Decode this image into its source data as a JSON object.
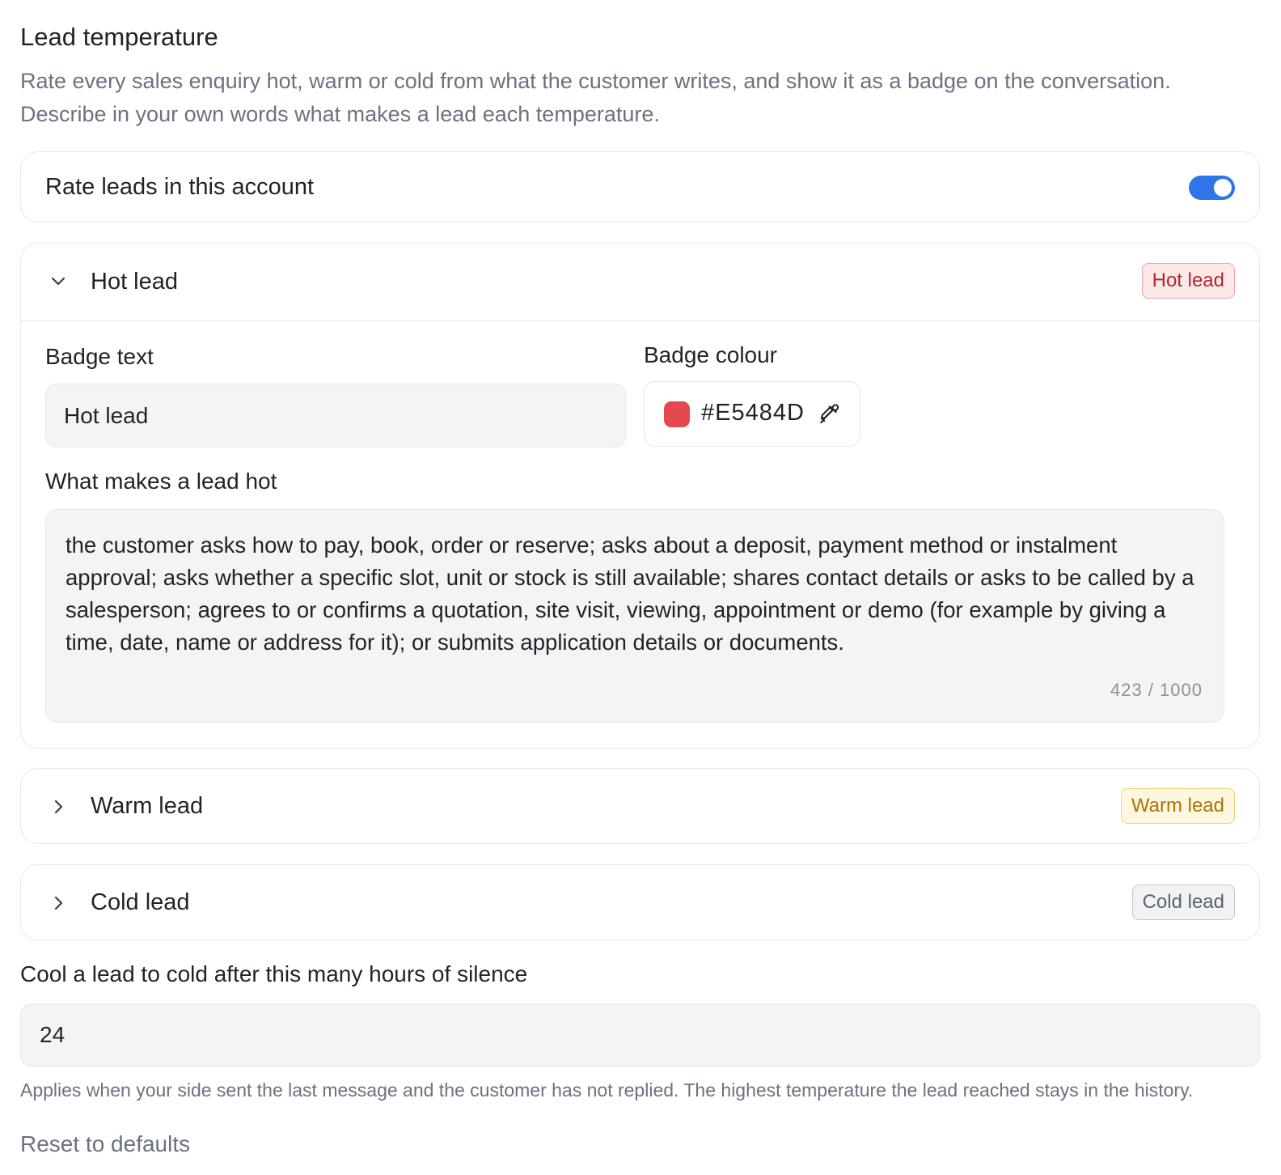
{
  "header": {
    "title": "Lead temperature",
    "description": "Rate every sales enquiry hot, warm or cold from what the customer writes, and show it as a badge on the conversation. Describe in your own words what makes a lead each temperature."
  },
  "account_toggle": {
    "label": "Rate leads in this account",
    "enabled": true
  },
  "hot": {
    "title": "Hot lead",
    "badge": "Hot lead",
    "expanded": true,
    "badge_text_label": "Badge text",
    "badge_text_value": "Hot lead",
    "badge_colour_label": "Badge colour",
    "badge_colour_value": "#E5484D",
    "criteria_label": "What makes a lead hot",
    "criteria_text": "the customer asks how to pay, book, order or reserve; asks about a deposit, payment method or instalment approval; asks whether a specific slot, unit or stock is still available; shares contact details or asks to be called by a salesperson; agrees to or confirms a quotation, site visit, viewing, appointment or demo (for example by giving a time, date, name or address for it); or submits application details or documents.",
    "counter": "423 / 1000"
  },
  "warm": {
    "title": "Warm lead",
    "badge": "Warm lead",
    "expanded": false
  },
  "cold": {
    "title": "Cold lead",
    "badge": "Cold lead",
    "expanded": false
  },
  "cooldown": {
    "label": "Cool a lead to cold after this many hours of silence",
    "value": "24",
    "note": "Applies when your side sent the last message and the customer has not replied. The highest temperature the lead reached stays in the history."
  },
  "reset_label": "Reset to defaults",
  "colors": {
    "accent": "#2f74e9",
    "hot": "#E5484D",
    "warm": "#F5C542",
    "cold": "#8B919A"
  },
  "icons": {
    "expanded_chevron": "chevron-down-icon",
    "collapsed_chevron": "chevron-right-icon",
    "picker": "eyedropper-icon"
  }
}
